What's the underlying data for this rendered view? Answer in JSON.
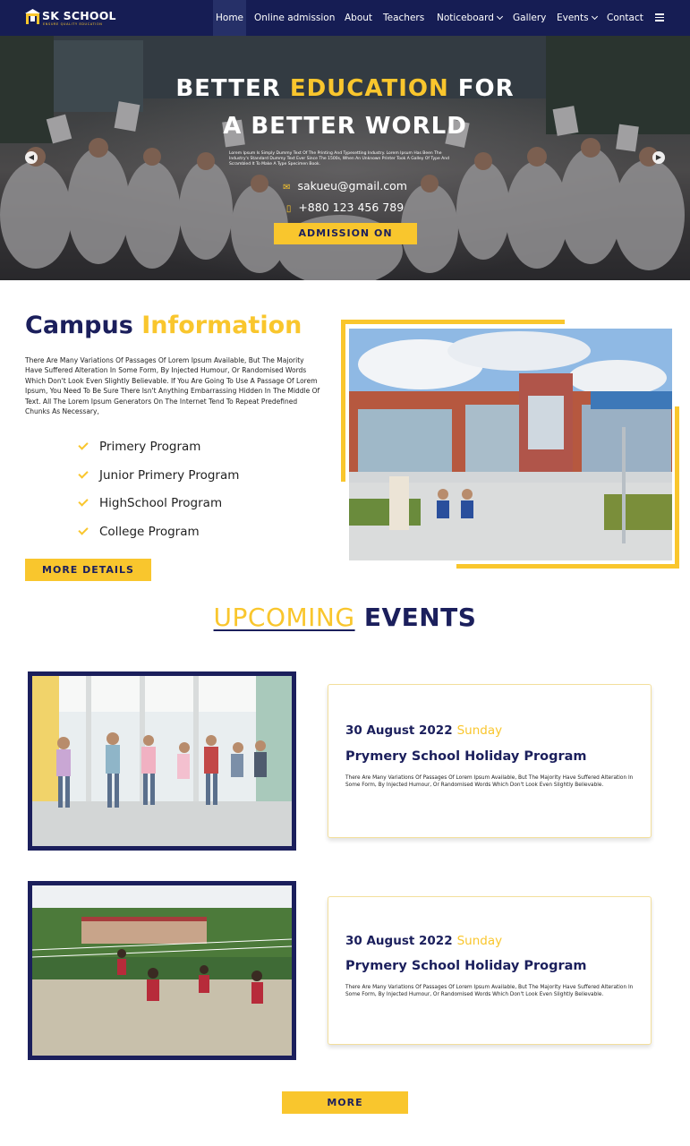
{
  "brand": {
    "name": "SK SCHOOL",
    "tagline": "ENSURE QUALITY EDUCATION",
    "colors": {
      "navy": "#161d54",
      "yellow": "#f9c62d"
    }
  },
  "nav": {
    "items": [
      {
        "label": "Home",
        "active": true
      },
      {
        "label": "Online admission"
      },
      {
        "label": "About"
      },
      {
        "label": "Teachers"
      },
      {
        "label": "Noticeboard",
        "dropdown": true
      },
      {
        "label": "Gallery"
      },
      {
        "label": "Events",
        "dropdown": true
      },
      {
        "label": "Contact"
      }
    ],
    "menu_icon": "hamburger-icon"
  },
  "hero": {
    "title_line1_a": "BETTER ",
    "title_line1_hl": "EDUCATION",
    "title_line1_b": " FOR",
    "title_line2": "A BETTER WORLD",
    "description": "Lorem Ipsum Is Simply Dummy Text Of The Printing And Typesetting Industry. Lorem Ipsum Has Been The Industry's Standard Dummy Text Ever Since The 1500s, When An Unknown Printer Took A Galley Of Type And Scrambled It To Make A Type Specimen Book.",
    "email": "sakueu@gmail.com",
    "phone": "+880 123 456 789",
    "button": "ADMISSION ON"
  },
  "campus": {
    "title_a": "Campus",
    "title_hl": "Information",
    "description": "There Are Many Variations Of Passages Of Lorem Ipsum Available, But The Majority Have Suffered Alteration In Some Form, By Injected Humour, Or Randomised Words Which Don't Look Even Slightly Believable. If You Are Going To Use A Passage Of Lorem Ipsum, You Need To Be Sure There Isn't Anything Embarrassing Hidden In The Middle Of Text. All The Lorem Ipsum Generators On The Internet Tend To Repeat Predefined Chunks As Necessary,",
    "programs": [
      "Primery Program",
      "Junior Primery Program",
      "HighSchool Program",
      "College Program"
    ],
    "button": "MORE DETAILS"
  },
  "events": {
    "title_hl": "UPCOMING",
    "title_b": "EVENTS",
    "items": [
      {
        "date": "30 August 2022",
        "day": "Sunday",
        "name": "Prymery School Holiday Program",
        "description": "There Are Many Variations Of Passages Of Lorem Ipsum Available, But The Majority Have Suffered Alteration In Some Form, By Injected Humour, Or Randomised Words Which Don't Look Even Slightly Believable."
      },
      {
        "date": "30 August 2022",
        "day": "Sunday",
        "name": "Prymery School Holiday Program",
        "description": "There Are Many Variations Of Passages Of Lorem Ipsum Available, But The Majority Have Suffered Alteration In Some Form, By Injected Humour, Or Randomised Words Which Don't Look Even Slightly Believable."
      }
    ],
    "more_button": "MORE"
  }
}
